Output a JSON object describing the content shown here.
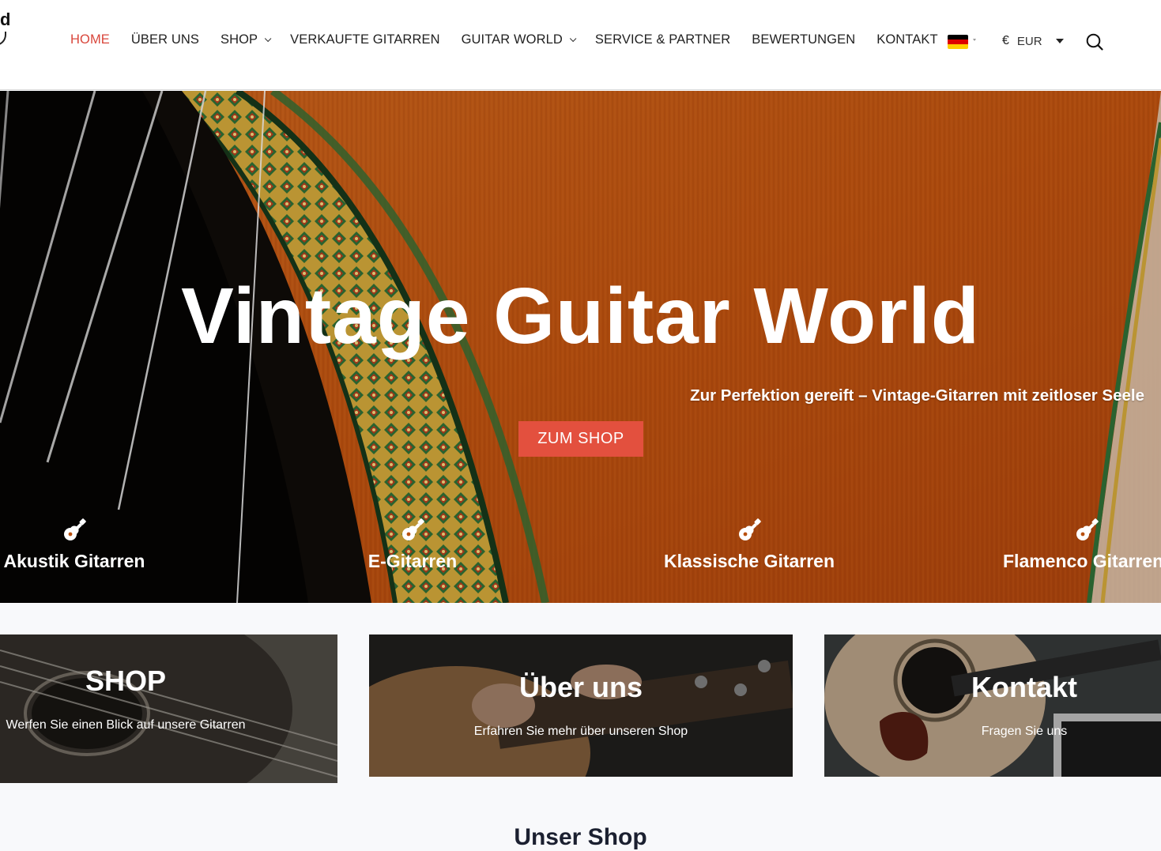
{
  "header": {
    "logo_fragment": "d",
    "nav": [
      {
        "label": "HOME",
        "active": true,
        "dropdown": false
      },
      {
        "label": "ÜBER UNS",
        "active": false,
        "dropdown": false
      },
      {
        "label": "SHOP",
        "active": false,
        "dropdown": true
      },
      {
        "label": "VERKAUFTE GITARREN",
        "active": false,
        "dropdown": false
      },
      {
        "label": "GUITAR WORLD",
        "active": false,
        "dropdown": true
      },
      {
        "label": "SERVICE & PARTNER",
        "active": false,
        "dropdown": false
      },
      {
        "label": "BEWERTUNGEN",
        "active": false,
        "dropdown": false
      },
      {
        "label": "KONTAKT",
        "active": false,
        "dropdown": false
      }
    ],
    "language_icon": "germany-flag-icon",
    "currency": {
      "symbol": "€",
      "code": "EUR"
    },
    "search_icon": "search-icon"
  },
  "hero": {
    "title": "Vintage Guitar World",
    "subtitle": "Zur Perfektion gereift – Vintage-Gitarren mit zeitloser Seele",
    "cta_label": "ZUM SHOP",
    "categories": [
      {
        "label": "Akustik Gitarren",
        "icon": "guitar-icon"
      },
      {
        "label": "E-Gitarren",
        "icon": "guitar-icon"
      },
      {
        "label": "Klassische Gitarren",
        "icon": "guitar-icon"
      },
      {
        "label": "Flamenco Gitarren",
        "icon": "guitar-icon"
      }
    ]
  },
  "cards": [
    {
      "title": "SHOP",
      "subtitle": "Werfen Sie einen Blick auf unsere Gitarren"
    },
    {
      "title": "Über uns",
      "subtitle": "Erfahren Sie mehr über unseren Shop"
    },
    {
      "title": "Kontakt",
      "subtitle": "Fragen Sie uns"
    }
  ],
  "section": {
    "heading": "Unser Shop"
  },
  "colors": {
    "accent": "#e3503e",
    "nav_active": "#d9463b",
    "text": "#222222",
    "flag": [
      "#000000",
      "#dd0000",
      "#ffce00"
    ]
  }
}
